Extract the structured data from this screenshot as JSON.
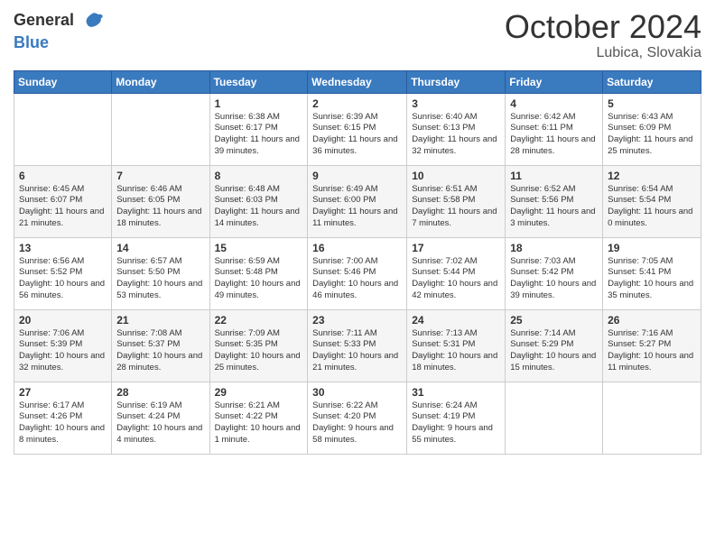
{
  "header": {
    "logo": {
      "general": "General",
      "blue": "Blue"
    },
    "title": "October 2024",
    "location": "Lubica, Slovakia"
  },
  "calendar": {
    "weekdays": [
      "Sunday",
      "Monday",
      "Tuesday",
      "Wednesday",
      "Thursday",
      "Friday",
      "Saturday"
    ],
    "weeks": [
      [
        {
          "day": "",
          "content": ""
        },
        {
          "day": "",
          "content": ""
        },
        {
          "day": "1",
          "content": "Sunrise: 6:38 AM\nSunset: 6:17 PM\nDaylight: 11 hours\nand 39 minutes."
        },
        {
          "day": "2",
          "content": "Sunrise: 6:39 AM\nSunset: 6:15 PM\nDaylight: 11 hours\nand 36 minutes."
        },
        {
          "day": "3",
          "content": "Sunrise: 6:40 AM\nSunset: 6:13 PM\nDaylight: 11 hours\nand 32 minutes."
        },
        {
          "day": "4",
          "content": "Sunrise: 6:42 AM\nSunset: 6:11 PM\nDaylight: 11 hours\nand 28 minutes."
        },
        {
          "day": "5",
          "content": "Sunrise: 6:43 AM\nSunset: 6:09 PM\nDaylight: 11 hours\nand 25 minutes."
        }
      ],
      [
        {
          "day": "6",
          "content": "Sunrise: 6:45 AM\nSunset: 6:07 PM\nDaylight: 11 hours\nand 21 minutes."
        },
        {
          "day": "7",
          "content": "Sunrise: 6:46 AM\nSunset: 6:05 PM\nDaylight: 11 hours\nand 18 minutes."
        },
        {
          "day": "8",
          "content": "Sunrise: 6:48 AM\nSunset: 6:03 PM\nDaylight: 11 hours\nand 14 minutes."
        },
        {
          "day": "9",
          "content": "Sunrise: 6:49 AM\nSunset: 6:00 PM\nDaylight: 11 hours\nand 11 minutes."
        },
        {
          "day": "10",
          "content": "Sunrise: 6:51 AM\nSunset: 5:58 PM\nDaylight: 11 hours\nand 7 minutes."
        },
        {
          "day": "11",
          "content": "Sunrise: 6:52 AM\nSunset: 5:56 PM\nDaylight: 11 hours\nand 3 minutes."
        },
        {
          "day": "12",
          "content": "Sunrise: 6:54 AM\nSunset: 5:54 PM\nDaylight: 11 hours\nand 0 minutes."
        }
      ],
      [
        {
          "day": "13",
          "content": "Sunrise: 6:56 AM\nSunset: 5:52 PM\nDaylight: 10 hours\nand 56 minutes."
        },
        {
          "day": "14",
          "content": "Sunrise: 6:57 AM\nSunset: 5:50 PM\nDaylight: 10 hours\nand 53 minutes."
        },
        {
          "day": "15",
          "content": "Sunrise: 6:59 AM\nSunset: 5:48 PM\nDaylight: 10 hours\nand 49 minutes."
        },
        {
          "day": "16",
          "content": "Sunrise: 7:00 AM\nSunset: 5:46 PM\nDaylight: 10 hours\nand 46 minutes."
        },
        {
          "day": "17",
          "content": "Sunrise: 7:02 AM\nSunset: 5:44 PM\nDaylight: 10 hours\nand 42 minutes."
        },
        {
          "day": "18",
          "content": "Sunrise: 7:03 AM\nSunset: 5:42 PM\nDaylight: 10 hours\nand 39 minutes."
        },
        {
          "day": "19",
          "content": "Sunrise: 7:05 AM\nSunset: 5:41 PM\nDaylight: 10 hours\nand 35 minutes."
        }
      ],
      [
        {
          "day": "20",
          "content": "Sunrise: 7:06 AM\nSunset: 5:39 PM\nDaylight: 10 hours\nand 32 minutes."
        },
        {
          "day": "21",
          "content": "Sunrise: 7:08 AM\nSunset: 5:37 PM\nDaylight: 10 hours\nand 28 minutes."
        },
        {
          "day": "22",
          "content": "Sunrise: 7:09 AM\nSunset: 5:35 PM\nDaylight: 10 hours\nand 25 minutes."
        },
        {
          "day": "23",
          "content": "Sunrise: 7:11 AM\nSunset: 5:33 PM\nDaylight: 10 hours\nand 21 minutes."
        },
        {
          "day": "24",
          "content": "Sunrise: 7:13 AM\nSunset: 5:31 PM\nDaylight: 10 hours\nand 18 minutes."
        },
        {
          "day": "25",
          "content": "Sunrise: 7:14 AM\nSunset: 5:29 PM\nDaylight: 10 hours\nand 15 minutes."
        },
        {
          "day": "26",
          "content": "Sunrise: 7:16 AM\nSunset: 5:27 PM\nDaylight: 10 hours\nand 11 minutes."
        }
      ],
      [
        {
          "day": "27",
          "content": "Sunrise: 6:17 AM\nSunset: 4:26 PM\nDaylight: 10 hours\nand 8 minutes."
        },
        {
          "day": "28",
          "content": "Sunrise: 6:19 AM\nSunset: 4:24 PM\nDaylight: 10 hours\nand 4 minutes."
        },
        {
          "day": "29",
          "content": "Sunrise: 6:21 AM\nSunset: 4:22 PM\nDaylight: 10 hours\nand 1 minute."
        },
        {
          "day": "30",
          "content": "Sunrise: 6:22 AM\nSunset: 4:20 PM\nDaylight: 9 hours\nand 58 minutes."
        },
        {
          "day": "31",
          "content": "Sunrise: 6:24 AM\nSunset: 4:19 PM\nDaylight: 9 hours\nand 55 minutes."
        },
        {
          "day": "",
          "content": ""
        },
        {
          "day": "",
          "content": ""
        }
      ]
    ]
  }
}
